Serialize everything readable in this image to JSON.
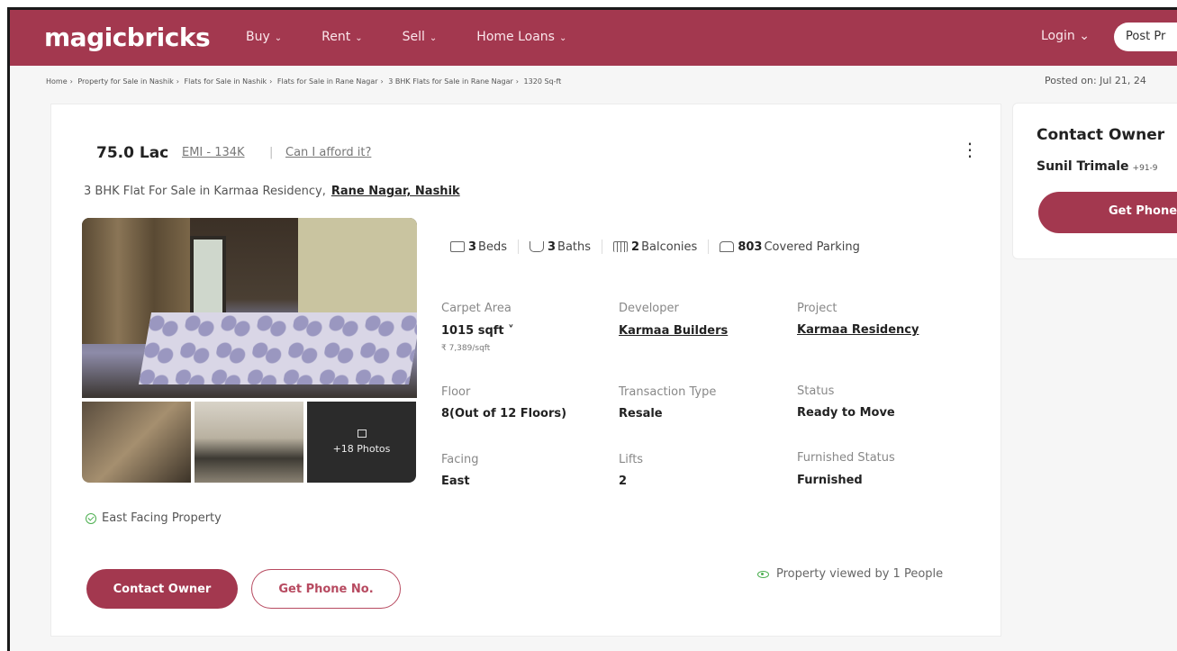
{
  "header": {
    "logo": "magicbricks",
    "nav": [
      "Buy",
      "Rent",
      "Sell",
      "Home Loans"
    ],
    "login": "Login",
    "post_button": "Post Pr"
  },
  "breadcrumb": [
    "Home",
    "Property for Sale in Nashik",
    "Flats for Sale in Nashik",
    "Flats for Sale in Rane Nagar",
    "3 BHK Flats for Sale in Rane Nagar",
    "1320 Sq-ft"
  ],
  "posted_on": "Posted on: Jul 21, 24",
  "listing": {
    "price": "75.0 Lac",
    "emi": "EMI - 134K",
    "afford": "Can I afford it?",
    "title": "3 BHK Flat For Sale in Karmaa Residency,",
    "locality": "Rane Nagar, Nashik",
    "photos_more": "+18 Photos",
    "features": {
      "beds_count": "3",
      "beds_label": "Beds",
      "baths_count": "3",
      "baths_label": "Baths",
      "balconies_count": "2",
      "balconies_label": "Balconies",
      "parking_count": "803",
      "parking_label": "Covered Parking"
    },
    "facts": {
      "carpet_area_label": "Carpet Area",
      "carpet_area_value": "1015 sqft ˅",
      "carpet_area_rate": "₹ 7,389/sqft",
      "developer_label": "Developer",
      "developer_value": "Karmaa Builders",
      "project_label": "Project",
      "project_value": "Karmaa Residency",
      "floor_label": "Floor",
      "floor_value": "8(Out of 12 Floors)",
      "transaction_label": "Transaction Type",
      "transaction_value": "Resale",
      "status_label": "Status",
      "status_value": "Ready to Move",
      "facing_label": "Facing",
      "facing_value": "East",
      "lifts_label": "Lifts",
      "lifts_value": "2",
      "furnished_label": "Furnished Status",
      "furnished_value": "Furnished"
    },
    "highlight": "East Facing Property",
    "contact_button": "Contact Owner",
    "phone_button": "Get Phone No.",
    "viewed": "Property viewed by 1 People"
  },
  "sidebar": {
    "title": "Contact Owner",
    "owner_name": "Sunil Trimale",
    "owner_phone": "+91-9",
    "button": "Get Phone"
  },
  "colors": {
    "brand": "#a3384f",
    "accent_green": "#4caf50"
  }
}
